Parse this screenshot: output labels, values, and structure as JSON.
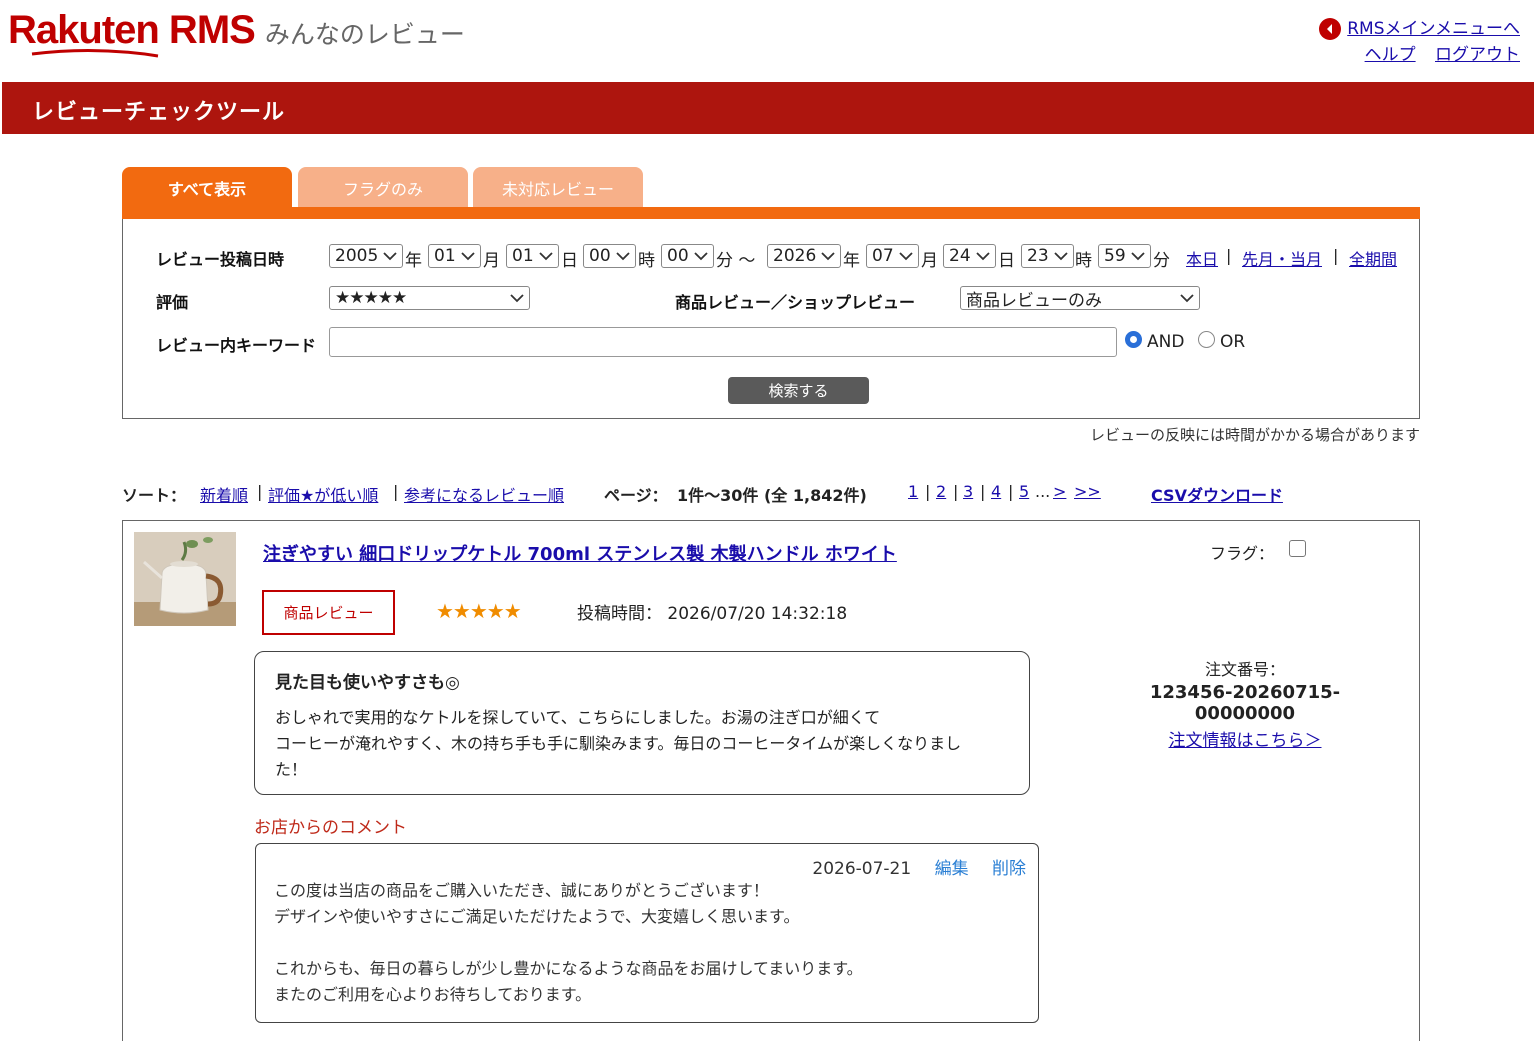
{
  "header": {
    "logo_main": "Rakuten RMS",
    "logo_sub": "みんなのレビュー",
    "rms_menu_link": "RMSメインメニューへ",
    "help_link": "ヘルプ",
    "logout_link": "ログアウト",
    "page_title": "レビューチェックツール"
  },
  "tabs": [
    {
      "label": "すべて表示",
      "active": true
    },
    {
      "label": "フラグのみ",
      "active": false
    },
    {
      "label": "未対応レビュー",
      "active": false
    }
  ],
  "search": {
    "date_label": "レビュー投稿日時",
    "from_year": "2005",
    "from_month": "01",
    "from_day": "01",
    "from_hour": "00",
    "from_min": "00",
    "to_year": "2026",
    "to_month": "07",
    "to_day": "24",
    "to_hour": "23",
    "to_min": "59",
    "unit_year": "年",
    "unit_month": "月",
    "unit_day": "日",
    "unit_hour": "時",
    "unit_min_tilde": "分 ～",
    "unit_min": "分",
    "quick_today": "本日",
    "quick_last_this_month": "先月・当月",
    "quick_all": "全期間",
    "sep": "|",
    "rating_label": "評価",
    "rating_value": "★★★★★",
    "type_label": "商品レビュー／ショップレビュー",
    "type_value": "商品レビューのみ",
    "keyword_label": "レビュー内キーワード",
    "keyword_value": "",
    "and_label": "AND",
    "or_label": "OR",
    "selected_operator": "AND",
    "search_button": "検索する",
    "note": "レビューの反映には時間がかかる場合があります"
  },
  "sort": {
    "label": "ソート：",
    "options": [
      "新着順",
      "評価★が低い順",
      "参考になるレビュー順"
    ],
    "page_label": "ページ：",
    "page_range": "1件～30件 (全 1,842件)",
    "pages": [
      "1",
      "2",
      "3",
      "4",
      "5"
    ],
    "ellipsis": "...",
    "next": ">",
    "last": ">>",
    "csv": "CSVダウンロード"
  },
  "review": {
    "product_title": "注ぎやすい 細口ドリップケトル 700ml ステンレス製 木製ハンドル ホワイト",
    "flag_label": "フラグ：",
    "badge": "商品レビュー",
    "stars": "★★★★★",
    "rating": 5,
    "posted_label": "投稿時間：",
    "posted_value": "2026/07/20 14:32:18",
    "title": "見た目も使いやすさも◎",
    "body_lines": [
      "おしゃれで実用的なケトルを探していて、こちらにしました。お湯の注ぎ口が細くて",
      "コーヒーが淹れやすく、木の持ち手も手に馴染みます。毎日のコーヒータイムが楽しくなりまし",
      "た！"
    ],
    "order_label": "注文番号：",
    "order_number": "123456-20260715-00000000",
    "order_link": "注文情報はこちら＞",
    "comment_label": "お店からのコメント",
    "comment_date": "2026-07-21",
    "comment_edit": "編集",
    "comment_delete": "削除",
    "comment_lines": [
      "この度は当店の商品をご購入いただき、誠にありがとうございます！",
      "デザインや使いやすさにご満足いただけたようで、大変嬉しく思います。",
      "",
      "これからも、毎日の暮らしが少し豊かになるような商品をお届けしてまいります。",
      "またのご利用を心よりお待ちしております。"
    ]
  },
  "colors": {
    "brand_red": "#bf0000",
    "header_bar": "#ad150e",
    "tab_active": "#f26a10",
    "tab_inactive": "#f7b089",
    "link": "#1a0dab",
    "star": "#f08c00"
  },
  "icons": [
    "back-arrow-icon",
    "chevron-down-icon",
    "product-thumbnail"
  ]
}
